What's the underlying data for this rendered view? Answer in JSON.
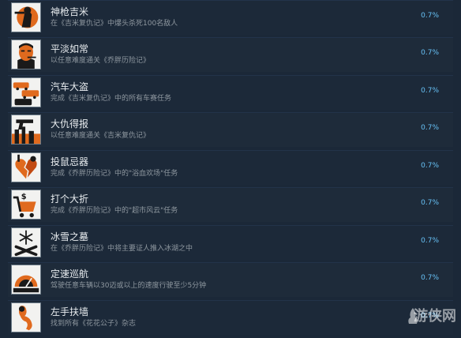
{
  "achievements": [
    {
      "title": "神枪吉米",
      "desc": "在《吉米复仇记》中爆头杀死100名敌人",
      "pct": "0.7%",
      "icon": "gunman-icon"
    },
    {
      "title": "平淡如常",
      "desc": "以任意难度通关《乔胖历险记》",
      "pct": "0.7%",
      "icon": "smoking-man-icon"
    },
    {
      "title": "汽车大盗",
      "desc": "完成《吉米复仇记》中的所有车赛任务",
      "pct": "0.7%",
      "icon": "cars-icon"
    },
    {
      "title": "大仇得报",
      "desc": "以任意难度通关《吉米复仇记》",
      "pct": "0.7%",
      "icon": "pistol-city-icon"
    },
    {
      "title": "投鼠忌器",
      "desc": "完成《乔胖历险记》中的\"浴血欢场\"任务",
      "pct": "0.7%",
      "icon": "broken-heart-icon"
    },
    {
      "title": "打个大折",
      "desc": "完成《乔胖历险记》中的\"超市风云\"任务",
      "pct": "0.7%",
      "icon": "shopping-cart-icon"
    },
    {
      "title": "冰雪之墓",
      "desc": "在《乔胖历险记》中将主要证人推入冰湖之中",
      "pct": "0.7%",
      "icon": "snow-crossbones-icon"
    },
    {
      "title": "定速巡航",
      "desc": "驾驶任意车辆以30迈或以上的速度行驶至少5分钟",
      "pct": "0.7%",
      "icon": "speedometer-icon"
    },
    {
      "title": "左手扶墙",
      "desc": "找到所有《花花公子》杂志",
      "pct": "0.7%",
      "icon": "pinup-icon"
    }
  ],
  "watermark": "游侠网"
}
